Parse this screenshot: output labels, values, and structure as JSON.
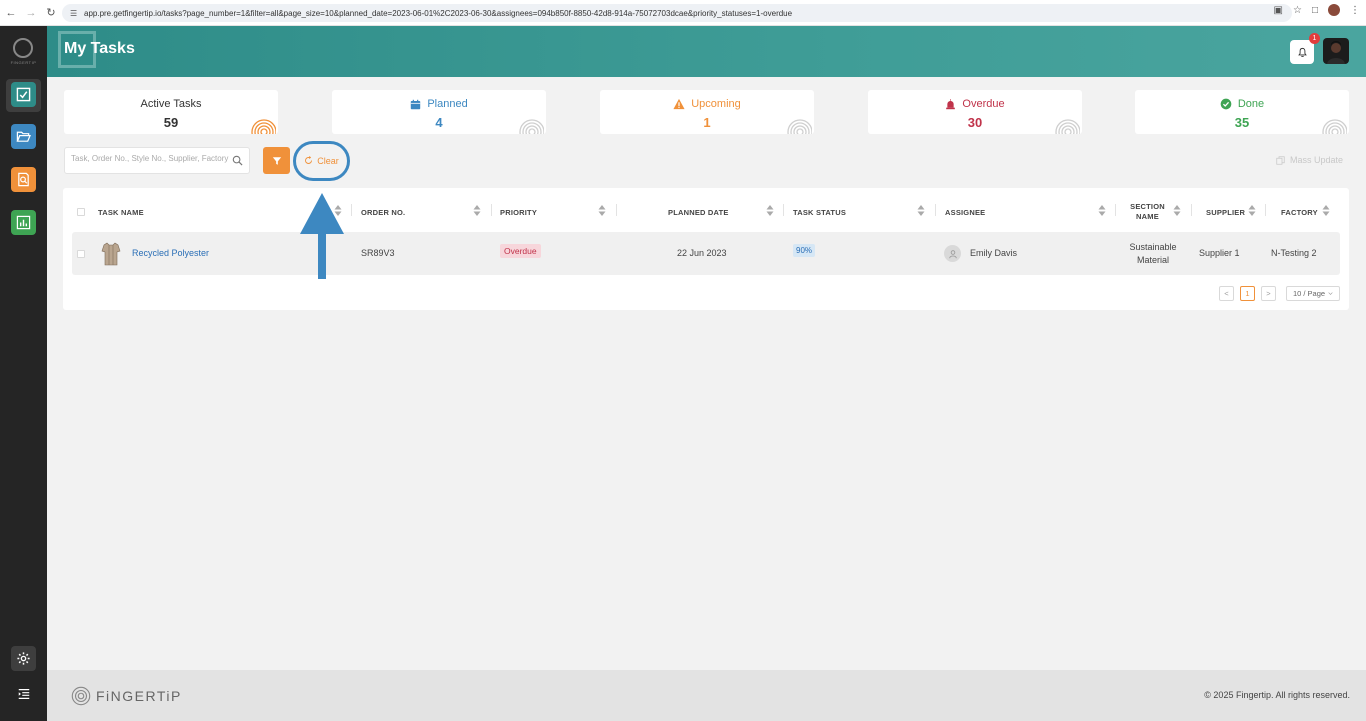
{
  "browser": {
    "url": "app.pre.getfingertip.io/tasks?page_number=1&filter=all&page_size=10&planned_date=2023-06-01%2C2023-06-30&assignees=094b850f-8850-42d8-914a-75072703dcae&priority_statuses=1-overdue"
  },
  "sidebar": {
    "logo_text": "FINGERTIP",
    "items": [
      {
        "name": "tasks",
        "color": "#2e8c88"
      },
      {
        "name": "folders",
        "color": "#3d88c1"
      },
      {
        "name": "reports",
        "color": "#f0913a"
      },
      {
        "name": "analytics",
        "color": "#3ea453"
      }
    ]
  },
  "header": {
    "title": "My Tasks",
    "notification_count": "1"
  },
  "stats": [
    {
      "label": "Active Tasks",
      "value": "59",
      "color": "#333333"
    },
    {
      "label": "Planned",
      "value": "4",
      "color": "#3d88c1"
    },
    {
      "label": "Upcoming",
      "value": "1",
      "color": "#f0913a"
    },
    {
      "label": "Overdue",
      "value": "30",
      "color": "#c0334a"
    },
    {
      "label": "Done",
      "value": "35",
      "color": "#3ea453"
    }
  ],
  "toolbar": {
    "search_placeholder": "Task, Order No., Style No., Supplier, Factory",
    "clear_label": "Clear",
    "mass_update_label": "Mass Update"
  },
  "table": {
    "headers": {
      "task_name": "TASK NAME",
      "order_no": "ORDER NO.",
      "priority": "PRIORITY",
      "planned_date": "PLANNED DATE",
      "task_status": "TASK STATUS",
      "assignee": "ASSIGNEE",
      "section_name_1": "SECTION",
      "section_name_2": "NAME",
      "supplier": "SUPPLIER",
      "factory": "FACTORY"
    },
    "rows": [
      {
        "task_name": "Recycled Polyester",
        "order_no": "SR89V3",
        "priority": "Overdue",
        "planned_date": "22 Jun 2023",
        "task_status": "90%",
        "assignee": "Emily Davis",
        "section_name_1": "Sustainable",
        "section_name_2": "Material",
        "supplier": "Supplier 1",
        "factory": "N-Testing 2"
      }
    ]
  },
  "pagination": {
    "prev": "<",
    "current_page": "1",
    "next": ">",
    "page_size": "10 / Page"
  },
  "footer": {
    "brand": "FiNGERTiP",
    "copyright": "© 2025 Fingertip. All rights reserved."
  }
}
